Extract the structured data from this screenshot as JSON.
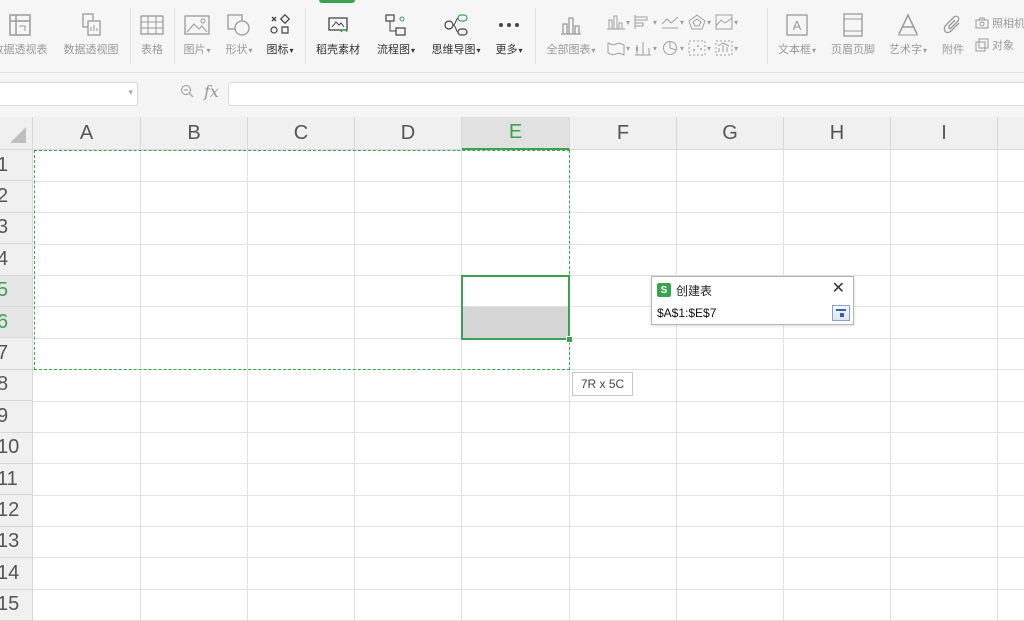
{
  "ribbon": {
    "items": [
      {
        "label": "数据透视表",
        "icon": "pivot-table-icon"
      },
      {
        "label": "数据透视图",
        "icon": "pivot-chart-icon"
      },
      {
        "label": "表格",
        "icon": "table-icon"
      },
      {
        "label": "图片",
        "icon": "picture-icon"
      },
      {
        "label": "形状",
        "icon": "shape-icon"
      },
      {
        "label": "图标",
        "icon": "icons-icon"
      },
      {
        "label": "稻壳素材",
        "icon": "docer-material-icon"
      },
      {
        "label": "流程图",
        "icon": "flowchart-icon"
      },
      {
        "label": "思维导图",
        "icon": "mindmap-icon"
      },
      {
        "label": "更多",
        "icon": "more-icon"
      },
      {
        "label": "全部图表",
        "icon": "all-charts-icon"
      },
      {
        "label": "文本框",
        "icon": "textbox-icon"
      },
      {
        "label": "页眉页脚",
        "icon": "header-footer-icon"
      },
      {
        "label": "艺术字",
        "icon": "wordart-icon"
      },
      {
        "label": "附件",
        "icon": "attachment-icon"
      }
    ],
    "right": {
      "camera": "照相机",
      "object": "对象"
    }
  },
  "formula_bar": {
    "fx": "fx",
    "name_box": "",
    "formula": ""
  },
  "columns": [
    "A",
    "B",
    "C",
    "D",
    "E",
    "F",
    "G",
    "H",
    "I"
  ],
  "rows": [
    "1",
    "2",
    "3",
    "4",
    "5",
    "6",
    "7",
    "8",
    "9",
    "10",
    "11",
    "12",
    "13",
    "14",
    "15"
  ],
  "selected_column": "E",
  "selected_rows": [
    "5",
    "6"
  ],
  "selection_tooltip": "7R x 5C",
  "dialog": {
    "title": "创建表",
    "logo": "S",
    "range": "$A$1:$E$7"
  },
  "colors": {
    "accent": "#3aa34f"
  }
}
